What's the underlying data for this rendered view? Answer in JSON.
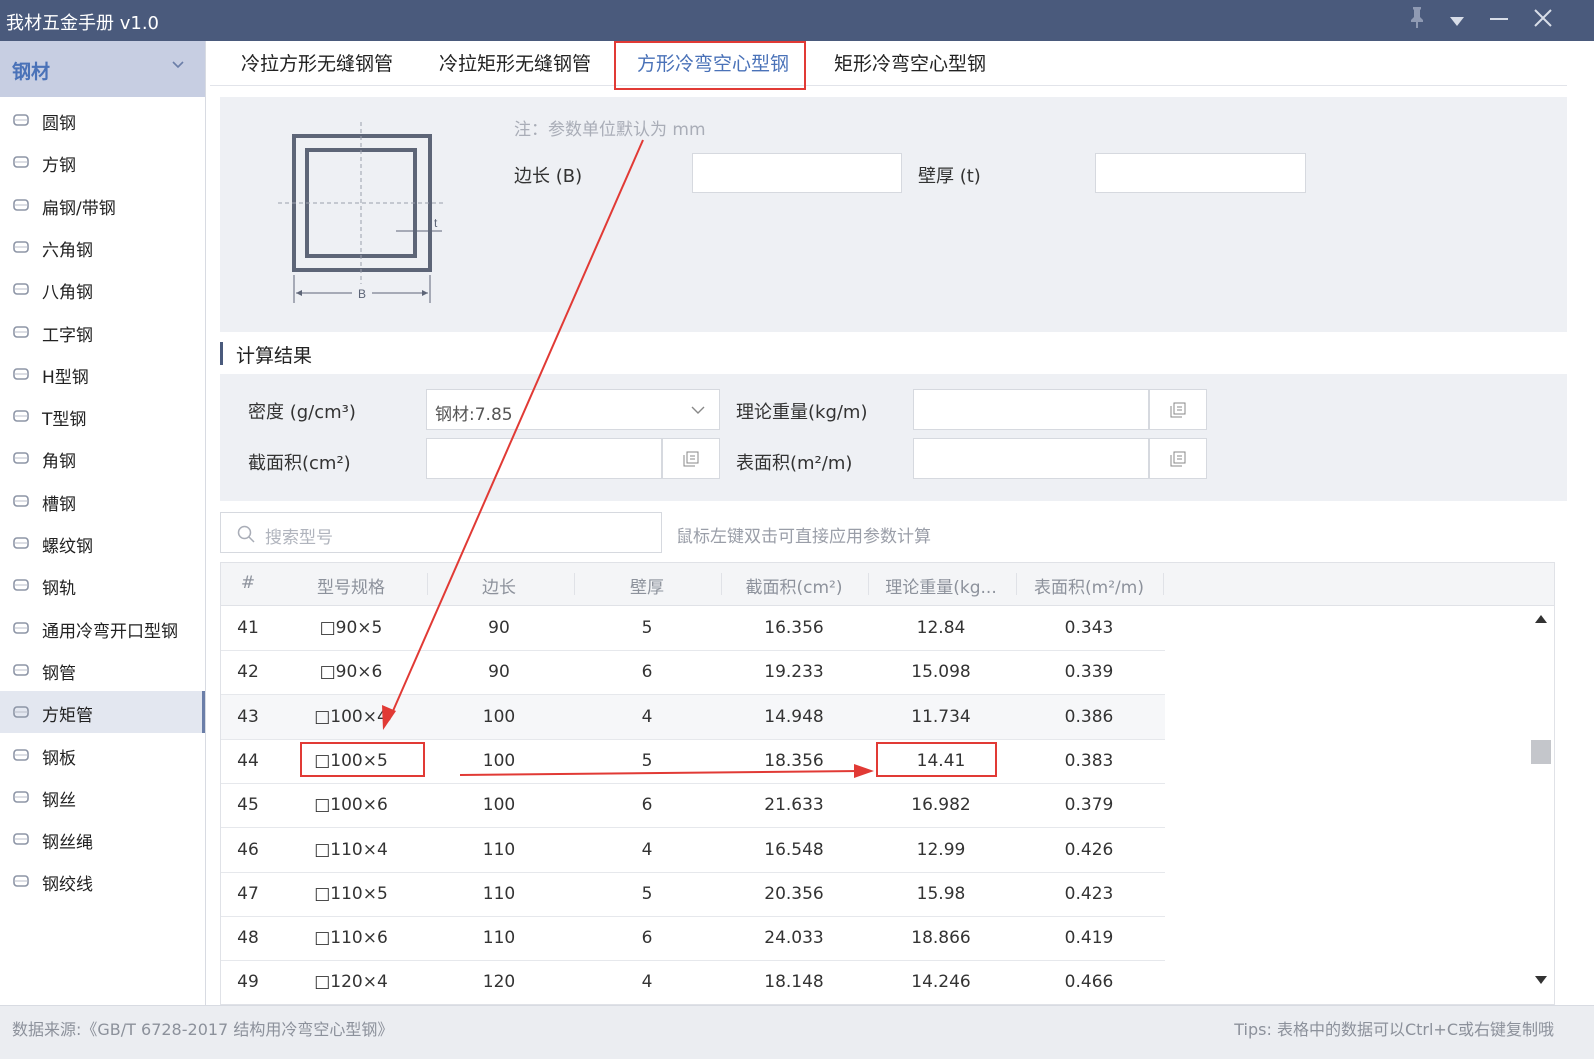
{
  "window": {
    "title": "我材五金手册 v1.0"
  },
  "sidebar": {
    "header": "钢材",
    "items": [
      {
        "label": "圆钢",
        "icon": "round-bar-icon"
      },
      {
        "label": "方钢",
        "icon": "square-bar-icon"
      },
      {
        "label": "扁钢/带钢",
        "icon": "flat-bar-icon"
      },
      {
        "label": "六角钢",
        "icon": "hex-bar-icon"
      },
      {
        "label": "八角钢",
        "icon": "octagon-bar-icon"
      },
      {
        "label": "工字钢",
        "icon": "i-beam-icon"
      },
      {
        "label": "H型钢",
        "icon": "h-beam-icon"
      },
      {
        "label": "T型钢",
        "icon": "t-beam-icon"
      },
      {
        "label": "角钢",
        "icon": "angle-steel-icon"
      },
      {
        "label": "槽钢",
        "icon": "channel-steel-icon"
      },
      {
        "label": "螺纹钢",
        "icon": "rebar-icon"
      },
      {
        "label": "钢轨",
        "icon": "rail-icon"
      },
      {
        "label": "通用冷弯开口型钢",
        "icon": "open-section-icon"
      },
      {
        "label": "钢管",
        "icon": "steel-pipe-icon"
      },
      {
        "label": "方矩管",
        "icon": "rect-tube-icon"
      },
      {
        "label": "钢板",
        "icon": "steel-plate-icon"
      },
      {
        "label": "钢丝",
        "icon": "steel-wire-icon"
      },
      {
        "label": "钢丝绳",
        "icon": "wire-rope-icon"
      },
      {
        "label": "钢绞线",
        "icon": "strand-icon"
      }
    ],
    "active_index": 14
  },
  "tabs": [
    {
      "label": "冷拉方形无缝钢管"
    },
    {
      "label": "冷拉矩形无缝钢管"
    },
    {
      "label": "方形冷弯空心型钢"
    },
    {
      "label": "矩形冷弯空心型钢"
    }
  ],
  "active_tab": 2,
  "params": {
    "note": "注：参数单位默认为 mm",
    "side_label": "边长 (B)",
    "side_value": "",
    "thickness_label": "壁厚 (t)",
    "thickness_value": "",
    "diagram_b": "B",
    "diagram_t": "t"
  },
  "results": {
    "title": "计算结果",
    "density_label": "密度 (g/cm³)",
    "density_value": "钢材:7.85",
    "weight_label": "理论重量(kg/m)",
    "weight_value": "",
    "area_label": "截面积(cm²)",
    "area_value": "",
    "surface_label": "表面积(m²/m)",
    "surface_value": ""
  },
  "search": {
    "placeholder": "搜索型号",
    "hint": "鼠标左键双击可直接应用参数计算"
  },
  "table": {
    "columns": [
      "#",
      "型号规格",
      "边长",
      "壁厚",
      "截面积(cm²)",
      "理论重量(kg...",
      "表面积(m²/m)"
    ],
    "rows": [
      [
        "41",
        "□90×5",
        "90",
        "5",
        "16.356",
        "12.84",
        "0.343"
      ],
      [
        "42",
        "□90×6",
        "90",
        "6",
        "19.233",
        "15.098",
        "0.339"
      ],
      [
        "43",
        "□100×4",
        "100",
        "4",
        "14.948",
        "11.734",
        "0.386"
      ],
      [
        "44",
        "□100×5",
        "100",
        "5",
        "18.356",
        "14.41",
        "0.383"
      ],
      [
        "45",
        "□100×6",
        "100",
        "6",
        "21.633",
        "16.982",
        "0.379"
      ],
      [
        "46",
        "□110×4",
        "110",
        "4",
        "16.548",
        "12.99",
        "0.426"
      ],
      [
        "47",
        "□110×5",
        "110",
        "5",
        "20.356",
        "15.98",
        "0.423"
      ],
      [
        "48",
        "□110×6",
        "110",
        "6",
        "24.033",
        "18.866",
        "0.419"
      ],
      [
        "49",
        "□120×4",
        "120",
        "4",
        "18.148",
        "14.246",
        "0.466"
      ]
    ]
  },
  "footer": {
    "source": "数据来源:《GB/T 6728-2017 结构用冷弯空心型钢》",
    "tips": "Tips: 表格中的数据可以Ctrl+C或右键复制哦"
  },
  "colors": {
    "titlebar": "#4a5a7c",
    "accent": "#4a72b8",
    "annotation": "#e13a35",
    "panel": "#eef0f4"
  }
}
